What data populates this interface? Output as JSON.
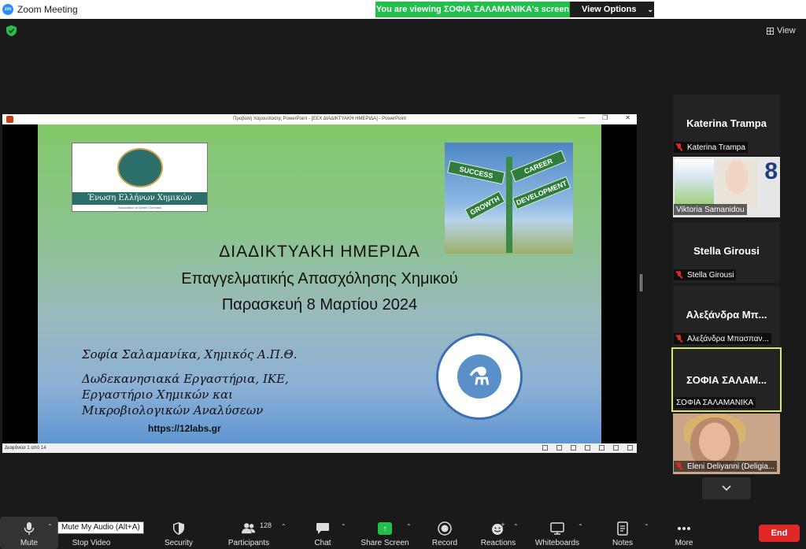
{
  "window": {
    "title": "Zoom Meeting",
    "logo": "zm"
  },
  "banner": {
    "viewing_text": "You are viewing ΣΟΦΙΑ ΣΑΛΑΜΑΝΙΚΑ's screen",
    "view_options": "View Options"
  },
  "view_button": {
    "label": "View"
  },
  "shared_window": {
    "caption": "Προβολή παρουσίασης PowerPoint - [ΕΕΧ ΔΙΑΔΙΚΤΥΑΚΗ ΗΜΕΡΙΔΑ] - PowerPoint",
    "status": "Διαφάνεια 1 από 14",
    "slide": {
      "logo_text": "Ένωση Ελλήνων Χημικών",
      "logo_subtext": "Association of Greek Chemists",
      "signs": [
        "SUCCESS",
        "CAREER",
        "GROWTH",
        "DEVELOPMENT"
      ],
      "title1": "ΔΙΑΔΙΚΤΥΑΚΗ ΗΜΕΡΙΔΑ",
      "title2": "Επαγγελματικής Απασχόλησης Χημικού",
      "title3": "Παρασκευή 8 Μαρτίου 2024",
      "author1": "Σοφία Σαλαμανίκα, Χημικός Α.Π.Θ.",
      "author2": "Δωδεκανησιακά Εργαστήρια, ΙΚΕ,",
      "author3": "Εργαστήριο Χημικών και",
      "author4": "Μικροβιολογικών Αναλύσεων",
      "website": "https://12labs.gr"
    }
  },
  "participants": [
    {
      "display": "Katerina Trampa",
      "label": "Katerina Trampa",
      "muted": true,
      "video": false
    },
    {
      "display": "",
      "label": "Viktoria Samanidou",
      "muted": false,
      "video": true,
      "poster_number": "8"
    },
    {
      "display": "Stella Girousi",
      "label": "Stella Girousi",
      "muted": true,
      "video": false
    },
    {
      "display": "Αλεξάνδρα Μπ...",
      "label": "Αλεξάνδρα Μπασπαν...",
      "muted": true,
      "video": false
    },
    {
      "display": "ΣΟΦΙΑ ΣΑΛΑΜ...",
      "label": "ΣΟΦΙΑ ΣΑΛΑΜΑΝΙΚΑ",
      "muted": false,
      "video": false,
      "active_speaker": true
    },
    {
      "display": "",
      "label": "Eleni Deliyanni (Deligia...",
      "muted": true,
      "video": true
    }
  ],
  "toolbar": {
    "mute": "Mute",
    "mute_tooltip": "Mute My Audio (Alt+A)",
    "stop_video": "Stop Video",
    "security": "Security",
    "participants": "Participants",
    "participants_count": "128",
    "chat": "Chat",
    "share_screen": "Share Screen",
    "record": "Record",
    "reactions": "Reactions",
    "whiteboards": "Whiteboards",
    "notes": "Notes",
    "more": "More",
    "end": "End"
  },
  "colors": {
    "zoom_blue": "#2d8cff",
    "share_green": "#23bf4d",
    "end_red": "#e02828",
    "active_border": "#d9e76a"
  }
}
